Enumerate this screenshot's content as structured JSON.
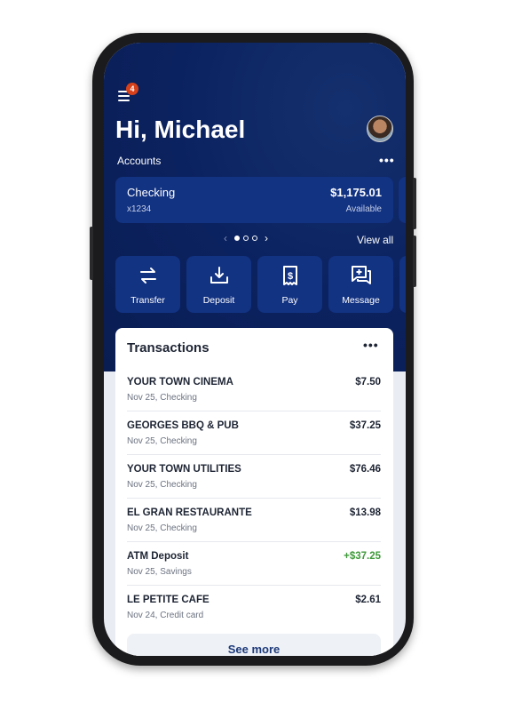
{
  "header": {
    "notification_count": "4",
    "greeting": "Hi, Michael",
    "accounts_label": "Accounts"
  },
  "account": {
    "name": "Checking",
    "number": "x1234",
    "balance": "$1,175.01",
    "balance_label": "Available"
  },
  "pager": {
    "current": 1,
    "total": 3,
    "view_all": "View all"
  },
  "actions": [
    {
      "label": "Transfer",
      "icon": "transfer-icon"
    },
    {
      "label": "Deposit",
      "icon": "deposit-icon"
    },
    {
      "label": "Pay",
      "icon": "receipt-dollar-icon"
    },
    {
      "label": "Message",
      "icon": "message-plus-icon"
    }
  ],
  "transactions": {
    "title": "Transactions",
    "items": [
      {
        "name": "YOUR TOWN CINEMA",
        "detail": "Nov 25, Checking",
        "amount": "$7.50"
      },
      {
        "name": "GEORGES BBQ & PUB",
        "detail": "Nov 25, Checking",
        "amount": "$37.25"
      },
      {
        "name": "YOUR TOWN UTILITIES",
        "detail": "Nov 25, Checking",
        "amount": "$76.46"
      },
      {
        "name": "EL GRAN RESTAURANTE",
        "detail": "Nov 25, Checking",
        "amount": "$13.98"
      },
      {
        "name": "ATM Deposit",
        "detail": "Nov 25, Savings",
        "amount": "+$37.25",
        "positive": true
      },
      {
        "name": "LE PETITE CAFE",
        "detail": "Nov 24, Credit card",
        "amount": "$2.61"
      }
    ],
    "see_more": "See more"
  },
  "colors": {
    "primary": "#0b2260",
    "card": "#123282",
    "positive": "#3f9a3a",
    "badge": "#d6401a"
  }
}
